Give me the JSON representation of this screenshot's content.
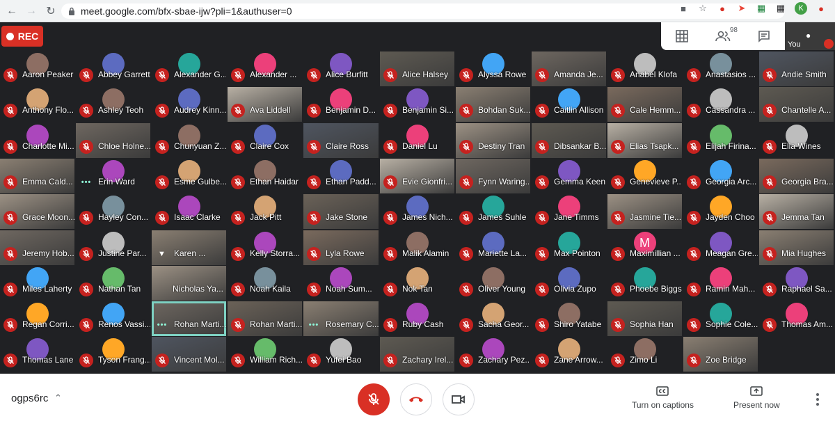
{
  "browser": {
    "url": "meet.google.com/bfx-sbae-ijw?pli=1&authuser=0",
    "profile_initial": "K",
    "icons": [
      "back-arrow-icon",
      "forward-arrow-icon",
      "reload-icon",
      "lock-icon",
      "camera-icon",
      "star-icon",
      "extension-icon",
      "extension-icon",
      "sheets-icon",
      "grid-icon",
      "profile-avatar",
      "update-icon"
    ]
  },
  "meet": {
    "rec_label": "REC",
    "people_count": "98",
    "you_label": "You",
    "colors": {
      "background": "#202124",
      "mic_off": "#c5221f",
      "rec": "#d93025",
      "speaking_outline": "#7ed1c2"
    },
    "participants": [
      {
        "name": "Aaron Peaker",
        "tile": "avatar",
        "mic": "off"
      },
      {
        "name": "Abbey Garrett",
        "tile": "avatar",
        "mic": "off"
      },
      {
        "name": "Alexander G...",
        "tile": "avatar",
        "mic": "off"
      },
      {
        "name": "Alexander ...",
        "tile": "avatar",
        "mic": "off"
      },
      {
        "name": "Alice Burfitt",
        "tile": "avatar",
        "mic": "off"
      },
      {
        "name": "Alice Halsey",
        "tile": "video",
        "mic": "off"
      },
      {
        "name": "Alyssa Rowe",
        "tile": "avatar",
        "mic": "off"
      },
      {
        "name": "Amanda Je...",
        "tile": "video",
        "mic": "off"
      },
      {
        "name": "Anabel Klofa",
        "tile": "avatar",
        "mic": "off"
      },
      {
        "name": "Anastasios ...",
        "tile": "avatar",
        "mic": "off"
      },
      {
        "name": "Andie Smith",
        "tile": "video",
        "mic": "off"
      },
      {
        "name": "Anthony Flo...",
        "tile": "avatar",
        "mic": "off"
      },
      {
        "name": "Ashley Teoh",
        "tile": "avatar",
        "mic": "off"
      },
      {
        "name": "Audrey Kinn...",
        "tile": "avatar",
        "mic": "off"
      },
      {
        "name": "Ava Liddell",
        "tile": "video",
        "mic": "off"
      },
      {
        "name": "Benjamin D...",
        "tile": "avatar",
        "mic": "off"
      },
      {
        "name": "Benjamin Si...",
        "tile": "avatar",
        "mic": "off"
      },
      {
        "name": "Bohdan Suk...",
        "tile": "video",
        "mic": "off"
      },
      {
        "name": "Caitlin Allison",
        "tile": "avatar",
        "mic": "off"
      },
      {
        "name": "Cale Hemm...",
        "tile": "video",
        "mic": "off"
      },
      {
        "name": "Cassandra ...",
        "tile": "avatar",
        "mic": "off"
      },
      {
        "name": "Chantelle A...",
        "tile": "video",
        "mic": "off"
      },
      {
        "name": "Charlotte Mi...",
        "tile": "avatar",
        "mic": "off"
      },
      {
        "name": "Chloe Holne...",
        "tile": "video",
        "mic": "off"
      },
      {
        "name": "Chunyuan Z...",
        "tile": "avatar",
        "mic": "off"
      },
      {
        "name": "Claire Cox",
        "tile": "avatar",
        "mic": "off"
      },
      {
        "name": "Claire Ross",
        "tile": "video",
        "mic": "off"
      },
      {
        "name": "Daniel Lu",
        "tile": "avatar",
        "mic": "off"
      },
      {
        "name": "Destiny Tran",
        "tile": "video",
        "mic": "off"
      },
      {
        "name": "Dibsankar B...",
        "tile": "video",
        "mic": "off"
      },
      {
        "name": "Elias Tsapk...",
        "tile": "video",
        "mic": "off"
      },
      {
        "name": "Elijah Firina...",
        "tile": "avatar",
        "mic": "off"
      },
      {
        "name": "Ella Wines",
        "tile": "avatar",
        "mic": "off"
      },
      {
        "name": "Emma Cald...",
        "tile": "video",
        "mic": "off"
      },
      {
        "name": "Erin Ward",
        "tile": "avatar",
        "mic": "talking"
      },
      {
        "name": "Esme Gulbe...",
        "tile": "avatar",
        "mic": "off"
      },
      {
        "name": "Ethan Haidar",
        "tile": "avatar",
        "mic": "off"
      },
      {
        "name": "Ethan Padd...",
        "tile": "avatar",
        "mic": "off"
      },
      {
        "name": "Evie Gionfri...",
        "tile": "video",
        "mic": "off"
      },
      {
        "name": "Fynn Waring...",
        "tile": "video",
        "mic": "off"
      },
      {
        "name": "Gemma Keen",
        "tile": "avatar",
        "mic": "off"
      },
      {
        "name": "Genevieve P...",
        "tile": "avatar",
        "mic": "off"
      },
      {
        "name": "Georgia Arc...",
        "tile": "avatar",
        "mic": "off"
      },
      {
        "name": "Georgia Bra...",
        "tile": "video",
        "mic": "off"
      },
      {
        "name": "Grace Moon...",
        "tile": "video",
        "mic": "off"
      },
      {
        "name": "Hayley Con...",
        "tile": "avatar",
        "mic": "off"
      },
      {
        "name": "Isaac Clarke",
        "tile": "avatar",
        "mic": "off"
      },
      {
        "name": "Jack Pitt",
        "tile": "avatar",
        "mic": "off"
      },
      {
        "name": "Jake Stone",
        "tile": "video",
        "mic": "off"
      },
      {
        "name": "James Nich...",
        "tile": "avatar",
        "mic": "off"
      },
      {
        "name": "James Suhle",
        "tile": "avatar",
        "mic": "off"
      },
      {
        "name": "Jane Timms",
        "tile": "avatar",
        "mic": "off"
      },
      {
        "name": "Jasmine Tie...",
        "tile": "video",
        "mic": "off"
      },
      {
        "name": "Jayden Choo",
        "tile": "avatar",
        "mic": "off"
      },
      {
        "name": "Jemma Tan",
        "tile": "video",
        "mic": "off"
      },
      {
        "name": "Jeremy Hob...",
        "tile": "video",
        "mic": "off"
      },
      {
        "name": "Justine Par...",
        "tile": "avatar",
        "mic": "off"
      },
      {
        "name": "Karen ...",
        "tile": "video",
        "mic": "pin"
      },
      {
        "name": "Kelly Storra...",
        "tile": "avatar",
        "mic": "off"
      },
      {
        "name": "Lyla Rowe",
        "tile": "video",
        "mic": "off"
      },
      {
        "name": "Malik Alamin",
        "tile": "avatar",
        "mic": "off"
      },
      {
        "name": "Mariette La...",
        "tile": "avatar",
        "mic": "off"
      },
      {
        "name": "Max Pointon",
        "tile": "avatar",
        "mic": "off"
      },
      {
        "name": "Maximillian ...",
        "tile": "avatar",
        "mic": "off",
        "initial": "M"
      },
      {
        "name": "Meagan Gre...",
        "tile": "avatar",
        "mic": "off"
      },
      {
        "name": "Mia Hughes",
        "tile": "video",
        "mic": "off"
      },
      {
        "name": "Miles Laherty",
        "tile": "avatar",
        "mic": "off"
      },
      {
        "name": "Nathan Tan",
        "tile": "avatar",
        "mic": "off"
      },
      {
        "name": "Nicholas Ya...",
        "tile": "video",
        "mic": "none"
      },
      {
        "name": "Noah Kaila",
        "tile": "avatar",
        "mic": "off"
      },
      {
        "name": "Noah Sum...",
        "tile": "avatar",
        "mic": "off"
      },
      {
        "name": "Nok Tan",
        "tile": "avatar",
        "mic": "off"
      },
      {
        "name": "Oliver Young",
        "tile": "avatar",
        "mic": "off"
      },
      {
        "name": "Olivia Zupo",
        "tile": "avatar",
        "mic": "off"
      },
      {
        "name": "Phoebe Biggs",
        "tile": "avatar",
        "mic": "off"
      },
      {
        "name": "Ramin Mah...",
        "tile": "avatar",
        "mic": "off"
      },
      {
        "name": "Raphael Sa...",
        "tile": "avatar",
        "mic": "off"
      },
      {
        "name": "Regan Corri...",
        "tile": "avatar",
        "mic": "off"
      },
      {
        "name": "Renos Vassi...",
        "tile": "avatar",
        "mic": "off"
      },
      {
        "name": "Rohan Marti...",
        "tile": "video",
        "mic": "talking",
        "speaking": true
      },
      {
        "name": "Rohan Marti...",
        "tile": "video",
        "mic": "off"
      },
      {
        "name": "Rosemary C...",
        "tile": "video",
        "mic": "talking"
      },
      {
        "name": "Ruby Cash",
        "tile": "avatar",
        "mic": "off"
      },
      {
        "name": "Sacha Geor...",
        "tile": "avatar",
        "mic": "off"
      },
      {
        "name": "Shiro Yatabe",
        "tile": "avatar",
        "mic": "off"
      },
      {
        "name": "Sophia Han",
        "tile": "video",
        "mic": "off"
      },
      {
        "name": "Sophie Cole...",
        "tile": "avatar",
        "mic": "off"
      },
      {
        "name": "Thomas Am...",
        "tile": "avatar",
        "mic": "off"
      },
      {
        "name": "Thomas Lane",
        "tile": "avatar",
        "mic": "off"
      },
      {
        "name": "Tyson Frang...",
        "tile": "avatar",
        "mic": "off"
      },
      {
        "name": "Vincent Mol...",
        "tile": "video",
        "mic": "off"
      },
      {
        "name": "William Rich...",
        "tile": "avatar",
        "mic": "off"
      },
      {
        "name": "Yufei Bao",
        "tile": "avatar",
        "mic": "off"
      },
      {
        "name": "Zachary Irel...",
        "tile": "video",
        "mic": "off"
      },
      {
        "name": "Zachary Pez...",
        "tile": "avatar",
        "mic": "off"
      },
      {
        "name": "Zane Arrow...",
        "tile": "avatar",
        "mic": "off"
      },
      {
        "name": "Zimo Li",
        "tile": "avatar",
        "mic": "off"
      },
      {
        "name": "Zoe Bridge",
        "tile": "video",
        "mic": "off"
      }
    ]
  },
  "bottom_bar": {
    "meeting_code": "ogps6rc",
    "captions_label": "Turn on captions",
    "present_label": "Present now"
  }
}
